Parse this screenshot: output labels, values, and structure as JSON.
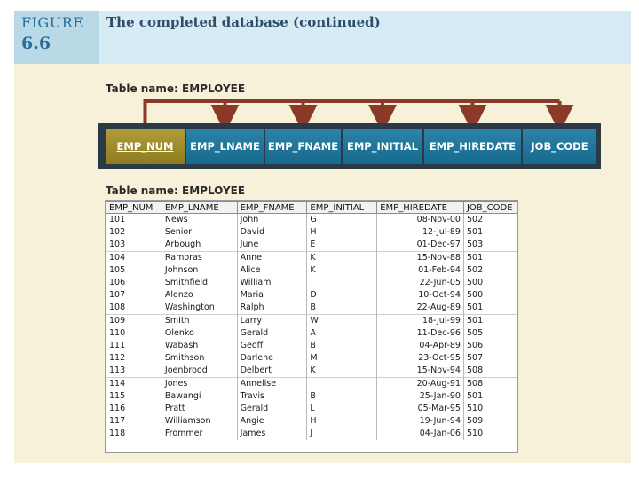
{
  "figure": {
    "word": "FIGURE",
    "number": "6.6",
    "title": "The completed database (continued)"
  },
  "schema": {
    "label": "Table name: EMPLOYEE",
    "columns": [
      "EMP_NUM",
      "EMP_LNAME",
      "EMP_FNAME",
      "EMP_INITIAL",
      "EMP_HIREDATE",
      "JOB_CODE"
    ],
    "primary_key": "EMP_NUM",
    "colors": {
      "key": "#a08c2e",
      "column": "#1f77a0",
      "arrow": "#8b3a28"
    }
  },
  "table": {
    "label": "Table name: EMPLOYEE",
    "headers": [
      "EMP_NUM",
      "EMP_LNAME",
      "EMP_FNAME",
      "EMP_INITIAL",
      "EMP_HIREDATE",
      "JOB_CODE"
    ],
    "rows": [
      [
        "101",
        "News",
        "John",
        "G",
        "08-Nov-00",
        "502"
      ],
      [
        "102",
        "Senior",
        "David",
        "H",
        "12-Jul-89",
        "501"
      ],
      [
        "103",
        "Arbough",
        "June",
        "E",
        "01-Dec-97",
        "503"
      ],
      [
        "104",
        "Ramoras",
        "Anne",
        "K",
        "15-Nov-88",
        "501"
      ],
      [
        "105",
        "Johnson",
        "Alice",
        "K",
        "01-Feb-94",
        "502"
      ],
      [
        "106",
        "Smithfield",
        "William",
        "",
        "22-Jun-05",
        "500"
      ],
      [
        "107",
        "Alonzo",
        "Maria",
        "D",
        "10-Oct-94",
        "500"
      ],
      [
        "108",
        "Washington",
        "Ralph",
        "B",
        "22-Aug-89",
        "501"
      ],
      [
        "109",
        "Smith",
        "Larry",
        "W",
        "18-Jul-99",
        "501"
      ],
      [
        "110",
        "Olenko",
        "Gerald",
        "A",
        "11-Dec-96",
        "505"
      ],
      [
        "111",
        "Wabash",
        "Geoff",
        "B",
        "04-Apr-89",
        "506"
      ],
      [
        "112",
        "Smithson",
        "Darlene",
        "M",
        "23-Oct-95",
        "507"
      ],
      [
        "113",
        "Joenbrood",
        "Delbert",
        "K",
        "15-Nov-94",
        "508"
      ],
      [
        "114",
        "Jones",
        "Annelise",
        "",
        "20-Aug-91",
        "508"
      ],
      [
        "115",
        "Bawangi",
        "Travis",
        "B",
        "25-Jan-90",
        "501"
      ],
      [
        "116",
        "Pratt",
        "Gerald",
        "L",
        "05-Mar-95",
        "510"
      ],
      [
        "117",
        "Williamson",
        "Angie",
        "H",
        "19-Jun-94",
        "509"
      ],
      [
        "118",
        "Frommer",
        "James",
        "J",
        "04-Jan-06",
        "510"
      ]
    ]
  }
}
